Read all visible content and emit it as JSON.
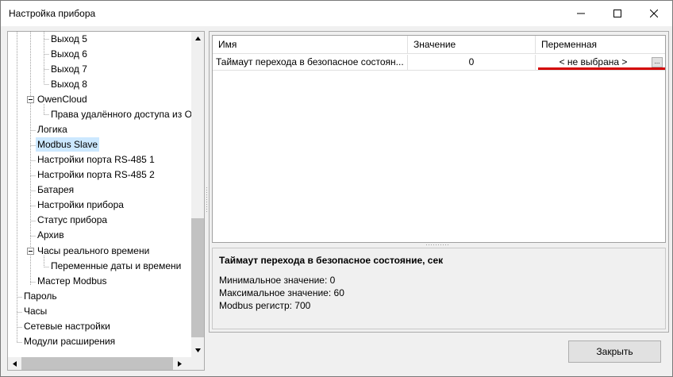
{
  "window": {
    "title": "Настройка прибора"
  },
  "tree": {
    "items": [
      {
        "label": "Выход 5"
      },
      {
        "label": "Выход 6"
      },
      {
        "label": "Выход 7"
      },
      {
        "label": "Выход 8"
      },
      {
        "label": "OwenCloud"
      },
      {
        "label": "Права удалённого доступа из О"
      },
      {
        "label": "Логика"
      },
      {
        "label": "Modbus Slave"
      },
      {
        "label": "Настройки порта RS-485 1"
      },
      {
        "label": "Настройки порта RS-485 2"
      },
      {
        "label": "Батарея"
      },
      {
        "label": "Настройки прибора"
      },
      {
        "label": "Статус прибора"
      },
      {
        "label": "Архив"
      },
      {
        "label": "Часы реального времени"
      },
      {
        "label": "Переменные даты и времени"
      },
      {
        "label": "Мастер Modbus"
      },
      {
        "label": "Пароль"
      },
      {
        "label": "Часы"
      },
      {
        "label": "Сетевые настройки"
      },
      {
        "label": "Модули расширения"
      }
    ]
  },
  "grid": {
    "columns": [
      "Имя",
      "Значение",
      "Переменная"
    ],
    "rows": [
      {
        "name": "Таймаут перехода в безопасное состоян...",
        "value": "0",
        "variable": "< не выбрана >",
        "button": "..."
      }
    ]
  },
  "description": {
    "title": "Таймаут перехода в безопасное состояние, сек",
    "min": "Минимальное значение: 0",
    "max": "Максимальное значение: 60",
    "register": "Modbus регистр: 700"
  },
  "buttons": {
    "close": "Закрыть"
  },
  "colors": {
    "selection": "#cce8ff",
    "highlight_underline": "#d40000"
  }
}
